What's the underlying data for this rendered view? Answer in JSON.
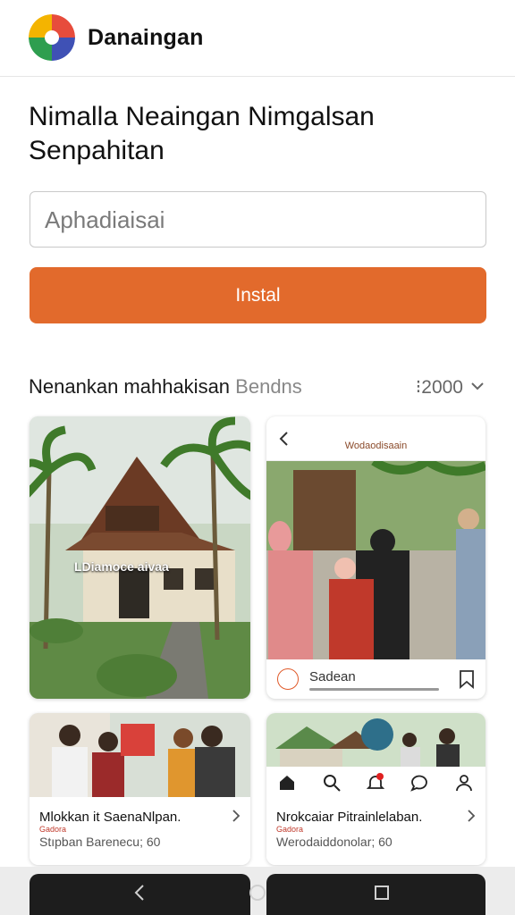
{
  "header": {
    "app_title": "Danaingan",
    "logo_icon": "multicolor-logo-icon"
  },
  "headline": "Nimalla Neaingan Nimgalsan Senpahitan",
  "search": {
    "placeholder": "Aphadiaisai"
  },
  "install_label": "Instal",
  "section": {
    "title_main": "Nenankan mahhakisan",
    "title_muted": "Bendns",
    "count": "⁝2000"
  },
  "cards": [
    {
      "image_label": "LDiamoce aivaa"
    },
    {
      "brand": "Wodaodisaain",
      "caption": "Sadean"
    },
    {
      "title": "Mlokkan it SaenaNlpan.",
      "tag": "Gadora",
      "subtitle": "Stıpban Barenecu; 60"
    },
    {
      "title": "Nrokcaiar Pitrainlelaban.",
      "tag": "Gadora",
      "subtitle": "Werodaiddonolar; 60"
    }
  ],
  "colors": {
    "accent": "#e26a2c",
    "text": "#111111",
    "muted": "#888888"
  },
  "icons": [
    "back-icon",
    "bookmark-icon",
    "home-icon",
    "search-icon",
    "notification-icon",
    "chat-icon",
    "profile-icon",
    "chevron-right-icon",
    "chevron-down-icon"
  ]
}
